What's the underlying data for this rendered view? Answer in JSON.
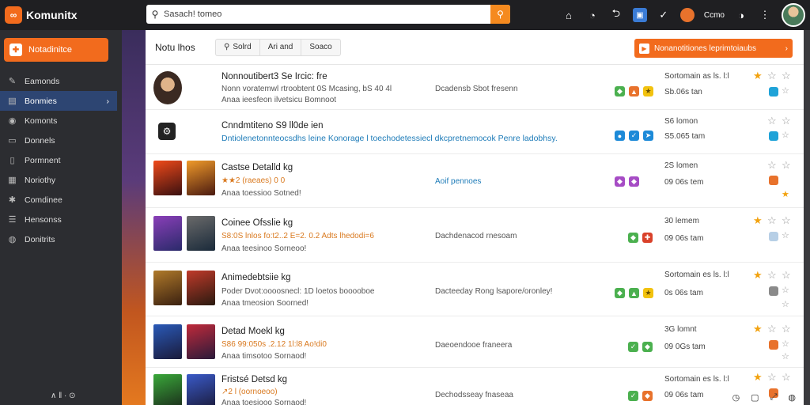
{
  "app": {
    "name": "Komunitx",
    "logo_letters": "∞"
  },
  "search": {
    "value": "Sasach! tomeo",
    "icon": "search-icon",
    "button_icon": "search-submit-icon"
  },
  "topbar": {
    "user_label": "Ccmo",
    "icons": [
      "home-icon",
      "clock-icon",
      "back-icon",
      "app-icon",
      "check-icon",
      "notification-dot",
      "info-icon",
      "avatar"
    ]
  },
  "sidebar": {
    "new_button": "Notadinitce",
    "items": [
      {
        "label": "Eamonds",
        "icon": "pen-icon"
      },
      {
        "label": "Bonmies",
        "icon": "box-icon",
        "active": true
      },
      {
        "label": "Komonts",
        "icon": "comment-icon"
      },
      {
        "label": "Donnels",
        "icon": "list-icon"
      },
      {
        "label": "Pormnent",
        "icon": "document-icon"
      },
      {
        "label": "Noriothy",
        "icon": "bell-icon"
      },
      {
        "label": "Comdinee",
        "icon": "users-icon"
      },
      {
        "label": "Hensonss",
        "icon": "grid-icon"
      },
      {
        "label": "Donitrits",
        "icon": "globe-icon"
      }
    ],
    "footer": "∧ ǁ · ⊙"
  },
  "main": {
    "title": "Notu lhos",
    "tabs": [
      "Solrd",
      "Ari and",
      "Soaco"
    ],
    "cta": "Nonanotitiones leprimtoiaubs"
  },
  "rows": [
    {
      "title": "Nonnoutibert3 Se  Ircic: fre",
      "line1": "Nonn voratemwl rtroobtent 0S Mcasing, bS 40 4l",
      "line2": "Anaa ieesfeon ilvetsicu Bomnoot",
      "mid": "Dcadensb Sbot fresenn",
      "date": "Sortomain as ls.  l:l",
      "date2": "Sb.06s tan"
    },
    {
      "title": "Cnndmtiteno S9  ll0de ien",
      "line1": "Dntiolenetonnteocsdhs  leine  Konorage l toechodetessiecl dkcpretnemocok Penre ladobhsy.",
      "mid": "",
      "date": "S6  lomon",
      "date2": "S5.065 tam"
    },
    {
      "title": "Castse Detalld kg",
      "line1": "★★2  (raeaes) 0 0",
      "line2": "Anaa toessioo Sotned!",
      "mid": "Aoif pennoes",
      "date": "2S  lomen",
      "date2": "09 06s tem"
    },
    {
      "title": "Coinee Ofsslie kg",
      "line1": "S8:0S  lnlos fo:t2..2 E=2.   0.2  Adts lhedodi=6",
      "line2": "Anaa teesinoo Sorneoo!",
      "mid": "Dachdenacod rnesoam",
      "date": "30  lemem",
      "date2": "09 06s tam"
    },
    {
      "title": "Animedebtsiie kg",
      "line1": "Poder  Dvot:oooosnecl:  1D  loetos booooboe",
      "line2": "Anaa tmeosion Soorned!",
      "mid": "Dacteeday Rong lsapore/oronley!",
      "date": "Sortomain es ls.  l:l",
      "date2": "0s 06s tam"
    },
    {
      "title": "Detad Moekl kg",
      "line1": "S86 99:050s  .2.12  1l:l8 Ao!di0",
      "line2": "Anaa timsotoo Sornaod!",
      "mid": "Daeoendooe franeera",
      "date": "3G  lomnt",
      "date2": "09 0Gs tam"
    },
    {
      "title": "Fristsé Detsd kg",
      "line1": "↗2  l  (oornoeoo)",
      "line2": "Anaa toesiooo Sornaod!",
      "mid": "Dechodsseay fnaseaa",
      "date": "Sortomain es ls.  l:l",
      "date2": "09 06s tam"
    }
  ],
  "footer_icons": [
    "clock-icon",
    "chat-icon",
    "expand-icon",
    "globe-icon"
  ],
  "colors": {
    "accent": "#f26b1d",
    "sidebar_bg": "#2c2d31",
    "active_bg": "#2d4572",
    "link": "#1d7bb8",
    "star": "#f2a20f"
  }
}
